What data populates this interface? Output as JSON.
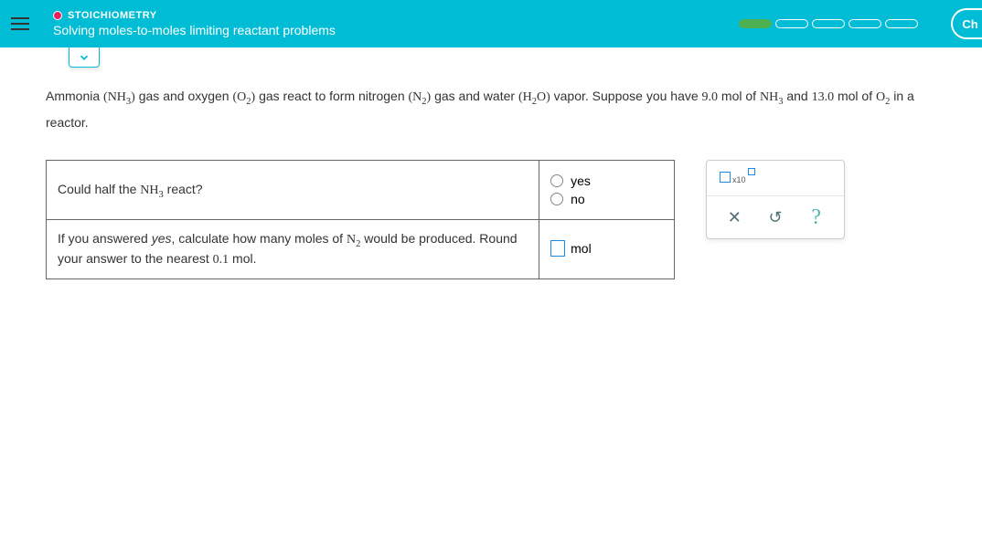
{
  "header": {
    "topic": "STOICHIOMETRY",
    "subtitle": "Solving moles-to-moles limiting reactant problems",
    "ch_label": "Ch"
  },
  "problem": {
    "p1": "Ammonia ",
    "f1a": "(NH",
    "f1b": "3",
    "f1c": ")",
    "p2": " gas and oxygen ",
    "f2a": "(O",
    "f2b": "2",
    "f2c": ")",
    "p3": " gas react to form nitrogen ",
    "f3a": "(N",
    "f3b": "2",
    "f3c": ")",
    "p4": " gas and water ",
    "f4a": "(H",
    "f4b": "2",
    "f4c": "O)",
    "p5": " vapor. Suppose you have ",
    "v1": "9.0",
    "p6": " mol of ",
    "f5a": "NH",
    "f5b": "3",
    "p7": " and ",
    "v2": "13.0",
    "p8": " mol of ",
    "f6a": "O",
    "f6b": "2",
    "p9": " in a reactor."
  },
  "q1": {
    "pre": "Could half the ",
    "fa": "NH",
    "fb": "3",
    "post": " react?",
    "opt_yes": "yes",
    "opt_no": "no"
  },
  "q2": {
    "pre": "If you answered ",
    "yes": "yes",
    "mid": ", calculate how many moles of ",
    "fa": "N",
    "fb": "2",
    "post1": " would be produced. Round your answer to the nearest ",
    "prec": "0.1",
    "post2": " mol.",
    "unit": "mol"
  },
  "toolbox": {
    "sci_label": "x10",
    "clear": "✕",
    "reset": "↺",
    "help": "?"
  }
}
